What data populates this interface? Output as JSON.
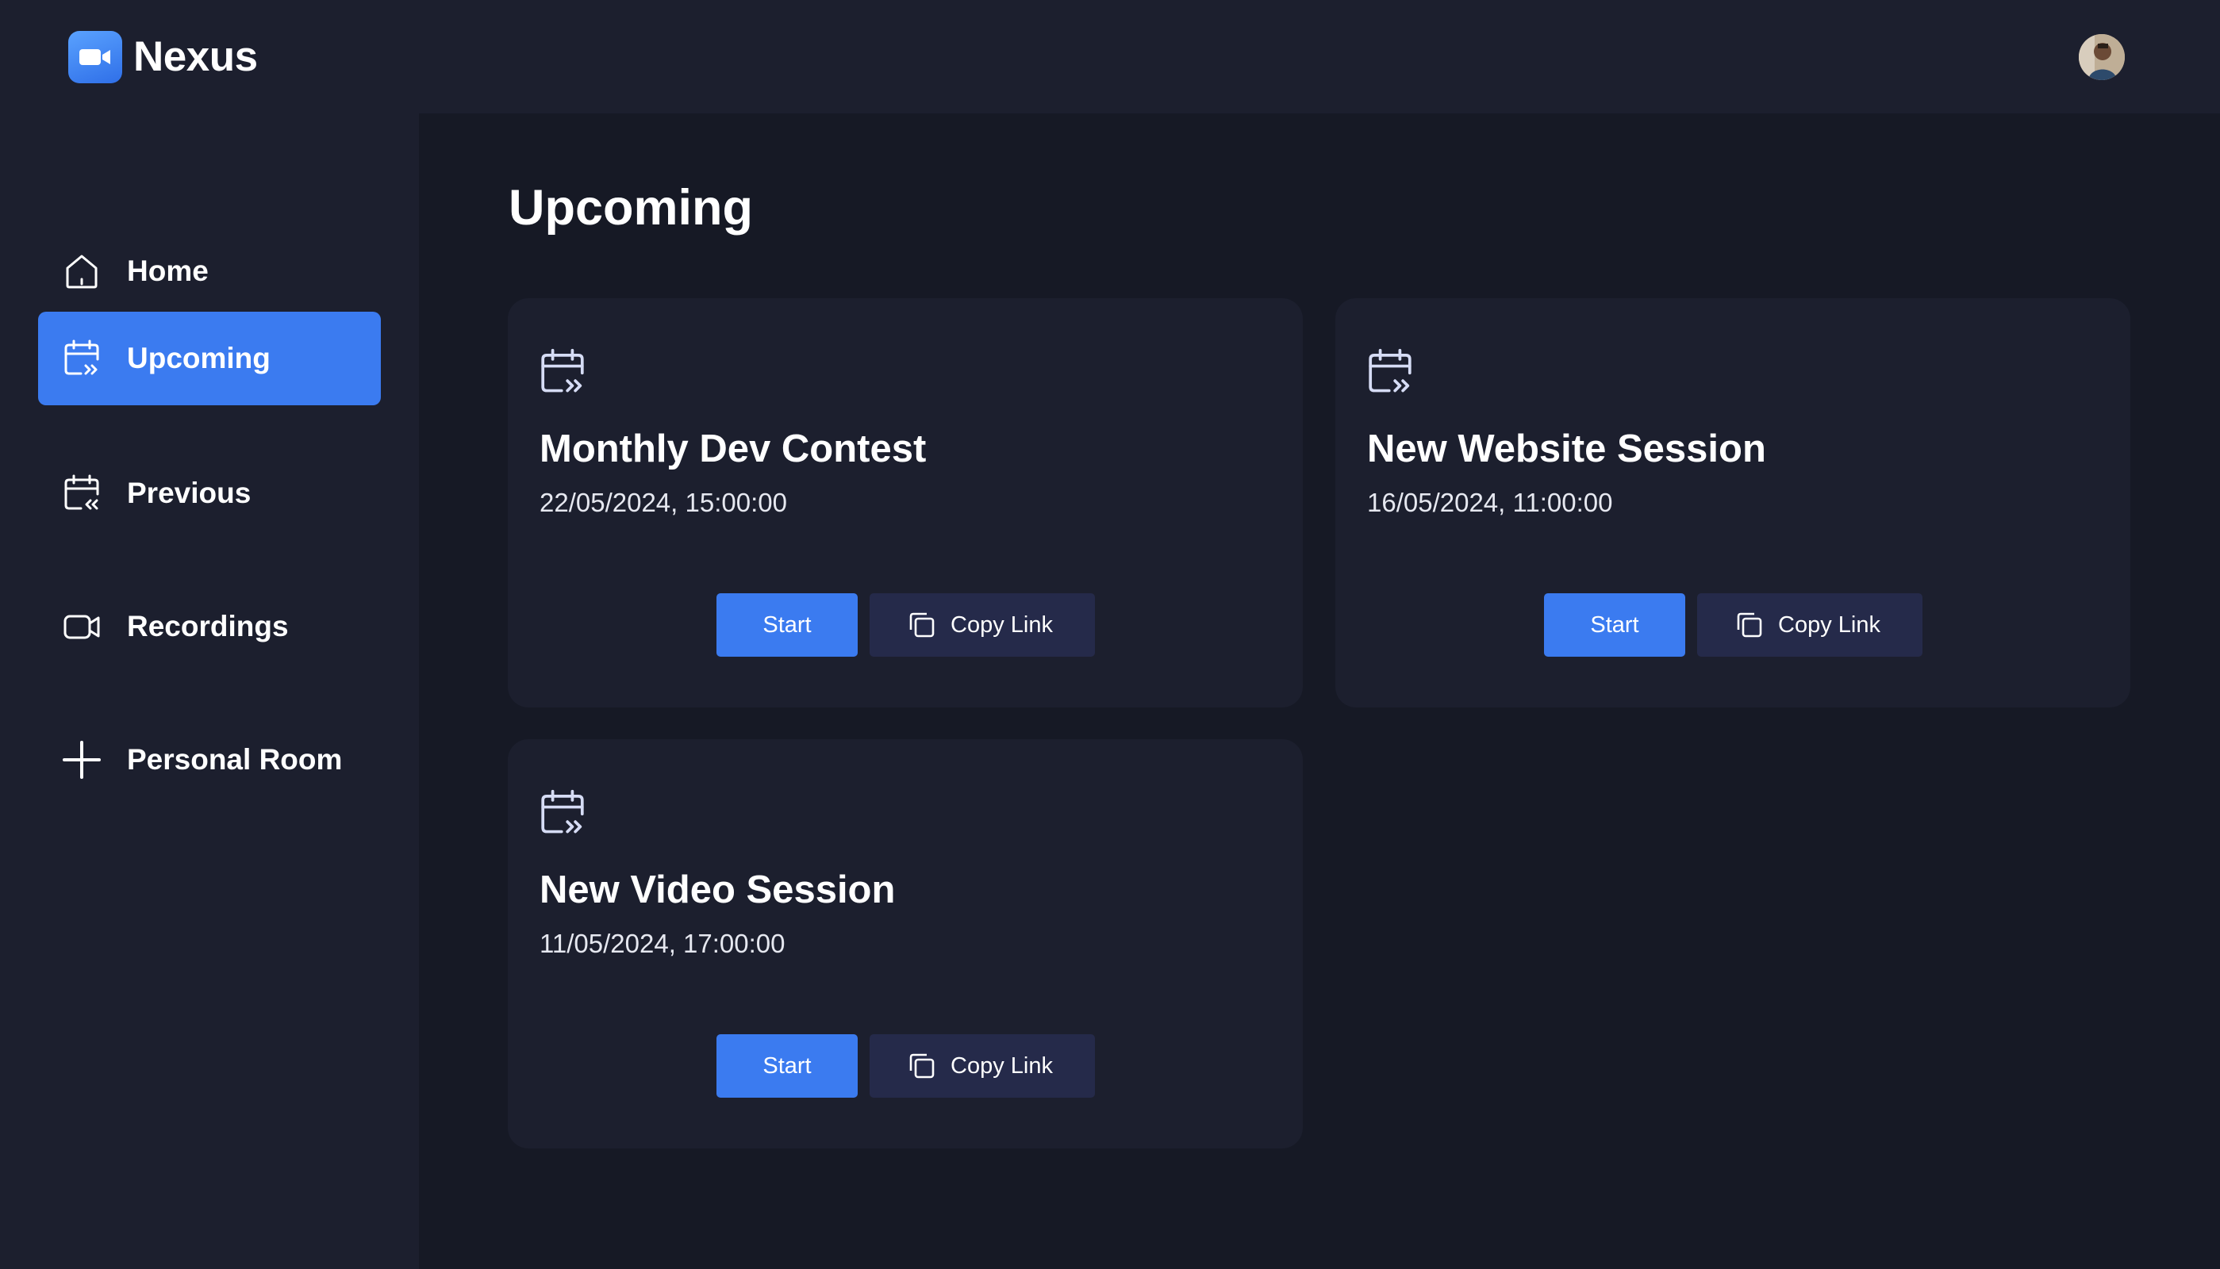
{
  "app": {
    "name": "Nexus",
    "accent": "#3b7bf0",
    "logo_icon": "video-camera-icon"
  },
  "sidebar": {
    "items": [
      {
        "label": "Home",
        "icon": "home-icon",
        "active": false
      },
      {
        "label": "Upcoming",
        "icon": "calendar-upcoming-icon",
        "active": true
      },
      {
        "label": "Previous",
        "icon": "calendar-previous-icon",
        "active": false
      },
      {
        "label": "Recordings",
        "icon": "video-icon",
        "active": false
      },
      {
        "label": "Personal Room",
        "icon": "plus-icon",
        "active": false
      }
    ]
  },
  "main": {
    "title": "Upcoming",
    "meetings": [
      {
        "title": "Monthly Dev Contest",
        "date": "22/05/2024, 15:00:00",
        "start_label": "Start",
        "copy_label": "Copy Link"
      },
      {
        "title": "New Website Session",
        "date": "16/05/2024, 11:00:00",
        "start_label": "Start",
        "copy_label": "Copy Link"
      },
      {
        "title": "New Video Session",
        "date": "11/05/2024, 17:00:00",
        "start_label": "Start",
        "copy_label": "Copy Link"
      }
    ]
  }
}
